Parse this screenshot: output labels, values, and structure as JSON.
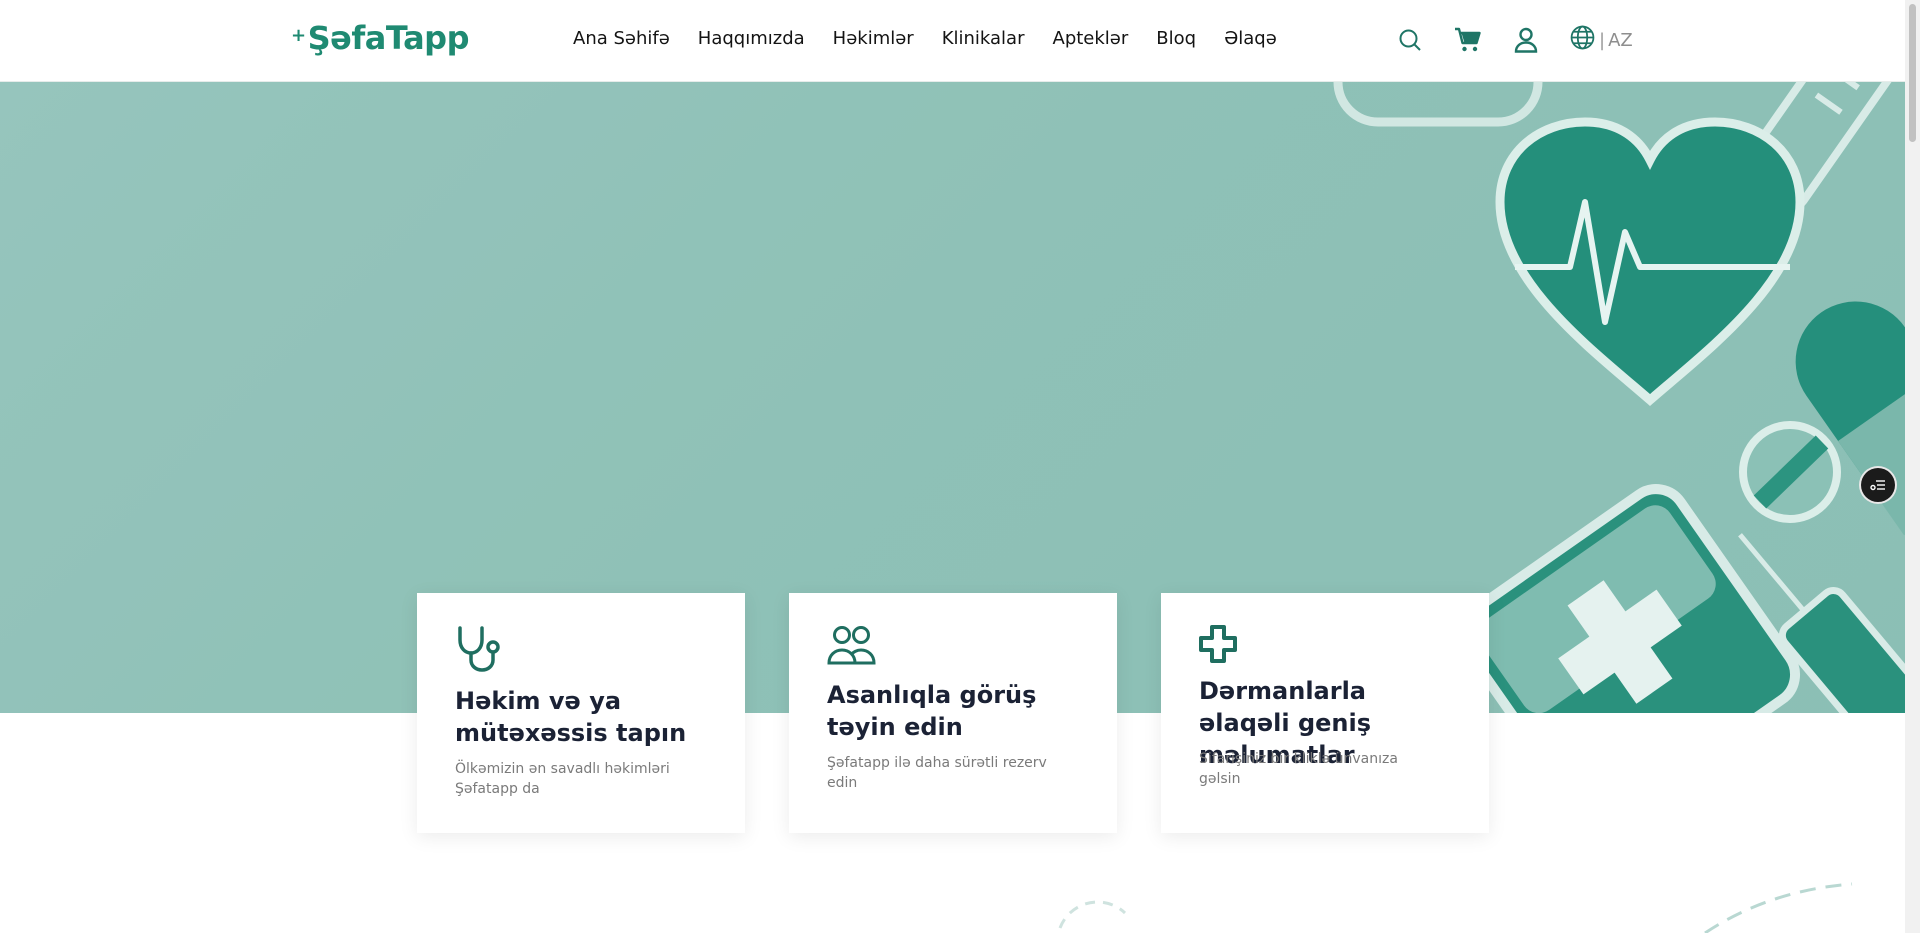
{
  "brand": {
    "plus": "+",
    "name": "ŞəfaTapp"
  },
  "nav": [
    {
      "label": "Ana Səhifə"
    },
    {
      "label": "Haqqımızda"
    },
    {
      "label": "Həkimlər"
    },
    {
      "label": "Klinikalar"
    },
    {
      "label": "Apteklər"
    },
    {
      "label": "Bloq"
    },
    {
      "label": "Əlaqə"
    }
  ],
  "header_icons": {
    "search": "search-icon",
    "cart": "cart-icon",
    "user": "user-icon",
    "language": "globe-icon"
  },
  "language": {
    "separator": "|",
    "current": "AZ"
  },
  "cards": [
    {
      "icon": "stethoscope-icon",
      "title": "Həkim və ya mütəxəssis tapın",
      "text": "Ölkəmizin ən savadlı həkimləri Şəfatapp da"
    },
    {
      "icon": "users-icon",
      "title": "Asanlıqla görüş təyin edin",
      "text": "Şəfatapp ilə daha sürətli rezerv edin"
    },
    {
      "icon": "medical-cross-icon",
      "title": "Dərmanlarla əlaqəli geniş məlumatlar",
      "text": "Sifarişiniz bir kliklə ünvanıza gəlsin"
    }
  ],
  "colors": {
    "brand": "#1f8a72",
    "hero_bg": "#8bbfb4",
    "dark_teal": "#218a78",
    "title": "#1b2235"
  }
}
